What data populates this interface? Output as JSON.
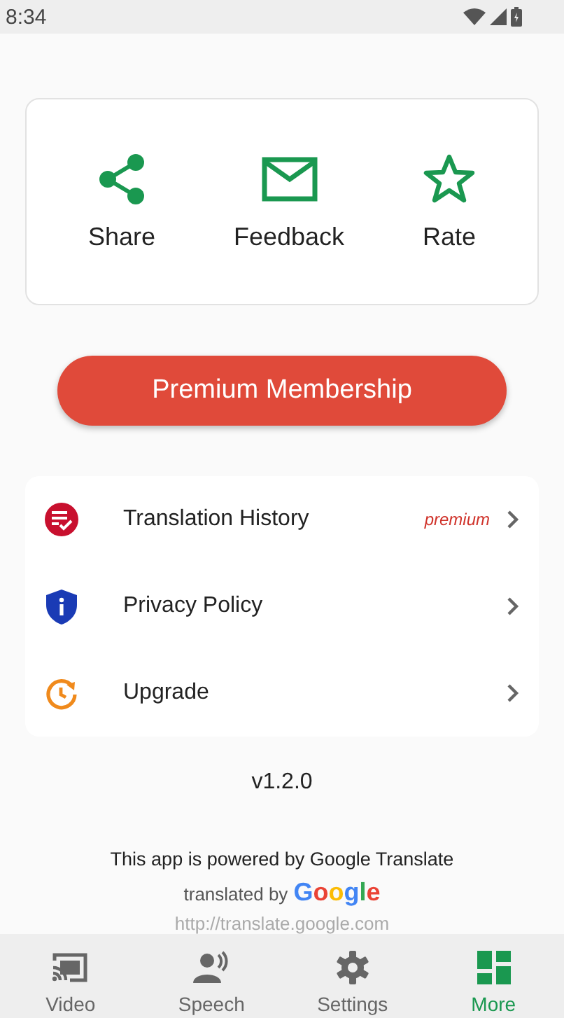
{
  "status_bar": {
    "time": "8:34"
  },
  "actions": [
    {
      "label": "Share",
      "kind": "share"
    },
    {
      "label": "Feedback",
      "kind": "feedback"
    },
    {
      "label": "Rate",
      "kind": "rate"
    }
  ],
  "premium_button": {
    "label": "Premium Membership"
  },
  "menu": [
    {
      "label": "Translation History",
      "kind": "history",
      "badge": "premium"
    },
    {
      "label": "Privacy Policy",
      "kind": "privacy"
    },
    {
      "label": "Upgrade",
      "kind": "upgrade"
    }
  ],
  "version": "v1.2.0",
  "footer": {
    "powered_by": "This app is powered by Google Translate",
    "translated_by": "translated by",
    "logo": "Google",
    "url": "http://translate.google.com"
  },
  "nav": [
    {
      "label": "Video",
      "kind": "video",
      "selected": false
    },
    {
      "label": "Speech",
      "kind": "speech",
      "selected": false
    },
    {
      "label": "Settings",
      "kind": "settings",
      "selected": false
    },
    {
      "label": "More",
      "kind": "more",
      "selected": true
    }
  ]
}
